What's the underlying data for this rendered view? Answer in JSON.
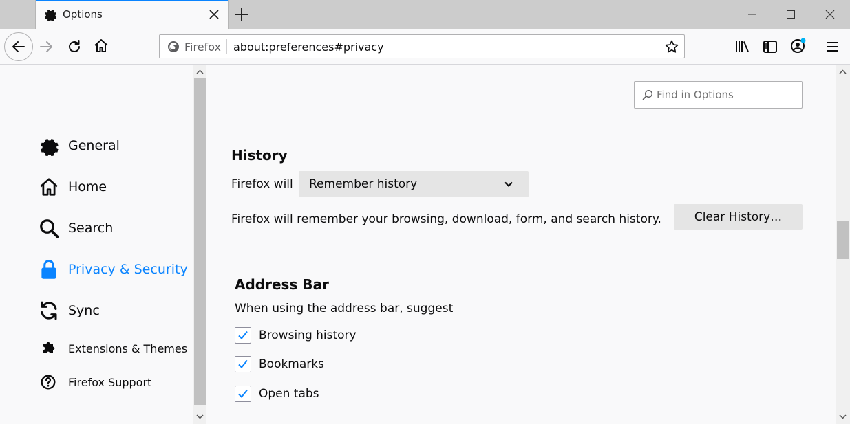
{
  "tab": {
    "title": "Options",
    "icon": "gear-icon"
  },
  "toolbar": {
    "identity_label": "Firefox",
    "url": "about:preferences#privacy"
  },
  "search": {
    "placeholder": "Find in Options"
  },
  "sidebar": {
    "items": [
      {
        "label": "General",
        "icon": "gear-icon"
      },
      {
        "label": "Home",
        "icon": "home-icon"
      },
      {
        "label": "Search",
        "icon": "search-icon"
      },
      {
        "label": "Privacy & Security",
        "icon": "lock-icon",
        "selected": true
      },
      {
        "label": "Sync",
        "icon": "sync-icon"
      },
      {
        "label": "Extensions & Themes",
        "icon": "puzzle-icon"
      },
      {
        "label": "Firefox Support",
        "icon": "help-icon"
      }
    ]
  },
  "history": {
    "heading": "History",
    "will_label": "Firefox will",
    "mode_selected": "Remember history",
    "description": "Firefox will remember your browsing, download, form, and search history.",
    "clear_button": "Clear History…"
  },
  "address_bar": {
    "heading": "Address Bar",
    "subheading": "When using the address bar, suggest",
    "options": [
      {
        "label": "Browsing history",
        "checked": true
      },
      {
        "label": "Bookmarks",
        "checked": true
      },
      {
        "label": "Open tabs",
        "checked": true
      }
    ]
  },
  "colors": {
    "accent": "#0a84ff",
    "sync_dot": "#00b3f4"
  }
}
